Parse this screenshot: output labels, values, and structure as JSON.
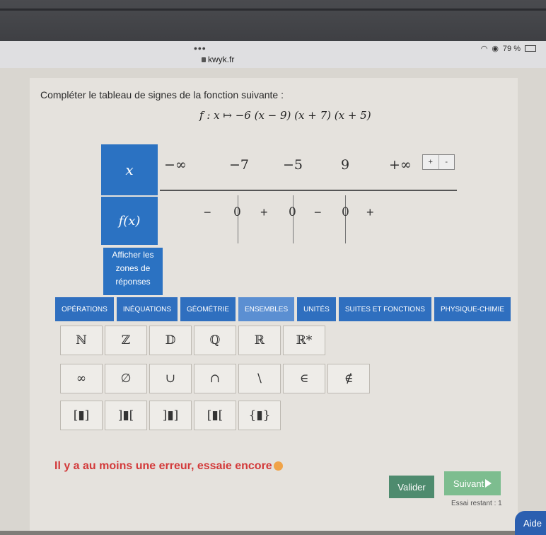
{
  "browser": {
    "url": "kwyk.fr",
    "battery": "79 %"
  },
  "exercise": {
    "instruction": "Compléter le tableau de signes de la fonction suivante :",
    "formula": "f : x ↦ −6 (x − 9) (x + 7) (x + 5)"
  },
  "table": {
    "x_header": "x",
    "f_header": "f(x)",
    "x_values": [
      "−∞",
      "−7",
      "−5",
      "9",
      "+∞"
    ],
    "signs": [
      "−",
      "0",
      "+",
      "0",
      "−",
      "0",
      "+"
    ],
    "add_label": "+",
    "remove_label": "-",
    "show_answers": "Afficher les zones de réponses"
  },
  "keyboard": {
    "tabs": [
      "OPÉRATIONS",
      "INÉQUATIONS",
      "GÉOMÉTRIE",
      "ENSEMBLES",
      "UNITÉS",
      "SUITES ET FONCTIONS",
      "PHYSIQUE-CHIMIE"
    ],
    "active_tab": "ENSEMBLES",
    "row1": [
      "ℕ",
      "ℤ",
      "𝔻",
      "ℚ",
      "ℝ",
      "ℝ*"
    ],
    "row2": [
      "∞",
      "∅",
      "∪",
      "∩",
      "\\",
      "∈",
      "∉"
    ],
    "row3": [
      "[▮]",
      "]▮[",
      "]▮]",
      "[▮[",
      "{▮}"
    ]
  },
  "feedback": {
    "message": "Il y a au moins une erreur, essaie encore"
  },
  "actions": {
    "valider": "Valider",
    "suivant": "Suivant",
    "essai": "Essai restant : 1",
    "aide": "Aide"
  }
}
